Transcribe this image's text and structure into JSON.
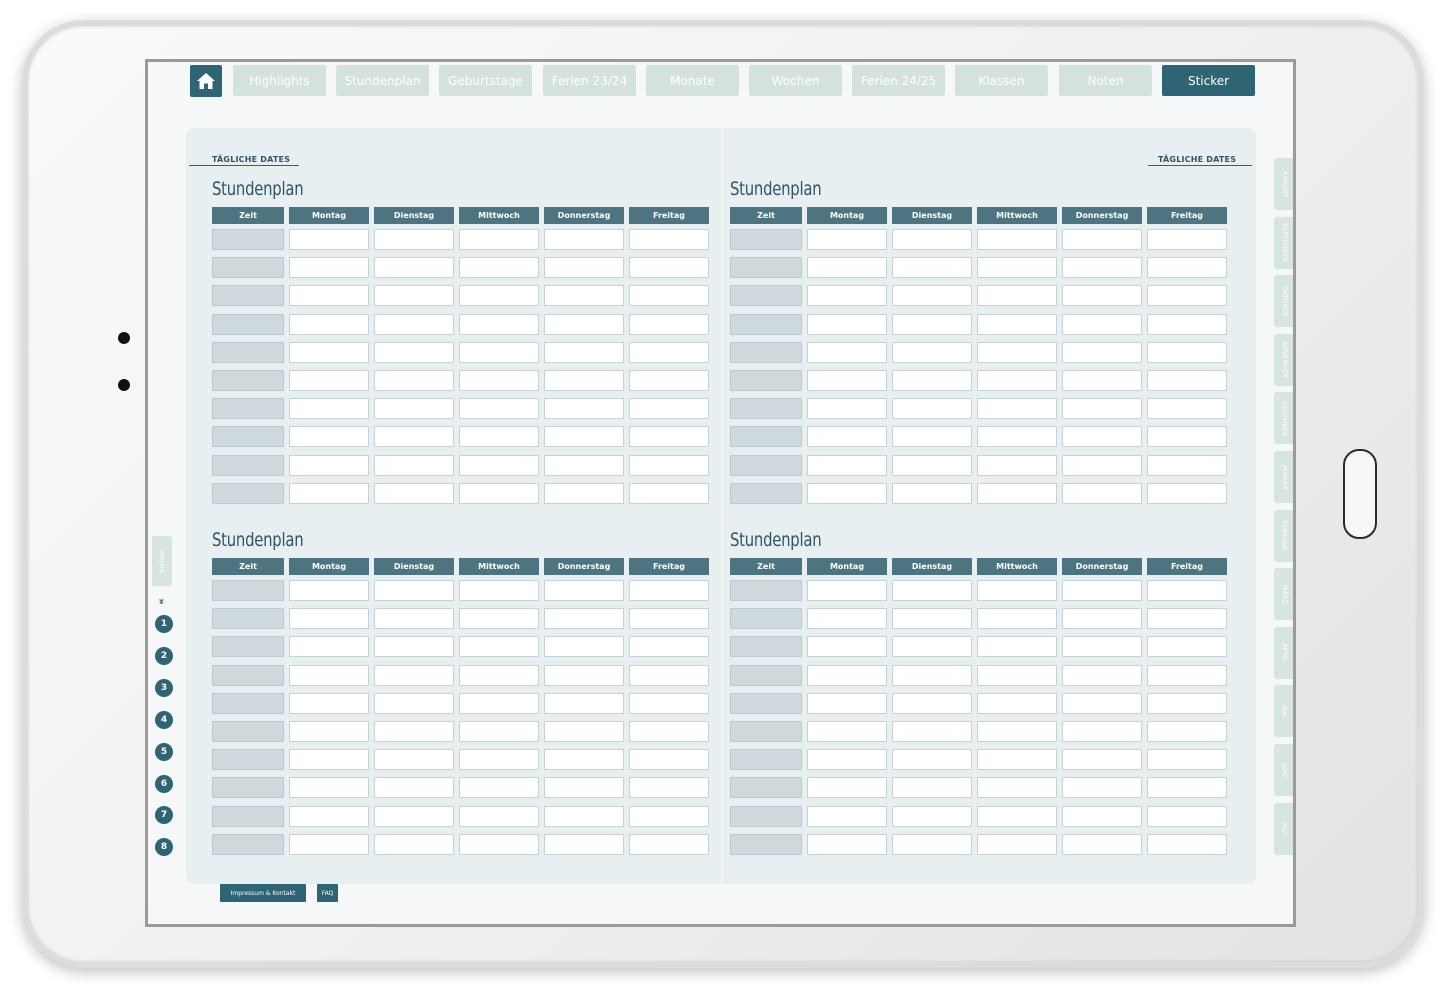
{
  "nav": {
    "home_icon": "home-icon",
    "tabs": [
      "Highlights",
      "Stundenplan",
      "Geburtstage",
      "Ferien 23/24",
      "Monate",
      "Wochen",
      "Ferien 24/25",
      "Klassen",
      "Noten",
      "Sticker"
    ],
    "active_tab": "Sticker"
  },
  "page": {
    "daily_label_left": "TÄGLICHE DATES",
    "daily_label_right": "TÄGLICHE DATES"
  },
  "plans": [
    {
      "title": "Stundenplan",
      "columns": [
        "Zeit",
        "Montag",
        "Dienstag",
        "Mittwoch",
        "Donnerstag",
        "Freitag"
      ],
      "rows": 10
    },
    {
      "title": "Stundenplan",
      "columns": [
        "Zeit",
        "Montag",
        "Dienstag",
        "Mittwoch",
        "Donnerstag",
        "Freitag"
      ],
      "rows": 10
    },
    {
      "title": "Stundenplan",
      "columns": [
        "Zeit",
        "Montag",
        "Dienstag",
        "Mittwoch",
        "Donnerstag",
        "Freitag"
      ],
      "rows": 10
    },
    {
      "title": "Stundenplan",
      "columns": [
        "Zeit",
        "Montag",
        "Dienstag",
        "Mittwoch",
        "Donnerstag",
        "Freitag"
      ],
      "rows": 10
    }
  ],
  "months": [
    "AUGUST",
    "SEPTEMBER",
    "OKTOBER",
    "NOVEMBER",
    "DEZEMBER",
    "JANUAR",
    "FEBRUAR",
    "MÄRZ",
    "APRIL",
    "MAI",
    "JUNI",
    "JULI"
  ],
  "sidebar": {
    "notes_label": "Notizen",
    "chevron": "»",
    "numbers": [
      "1",
      "2",
      "3",
      "4",
      "5",
      "6",
      "7",
      "8"
    ]
  },
  "footer": {
    "impressum": "Impressum & Kontakt",
    "faq": "FAQ"
  },
  "colors": {
    "accent": "#2e6574",
    "tab_inactive": "#d3e2dc",
    "header": "#4c7581",
    "page_bg": "#e8eff1"
  }
}
